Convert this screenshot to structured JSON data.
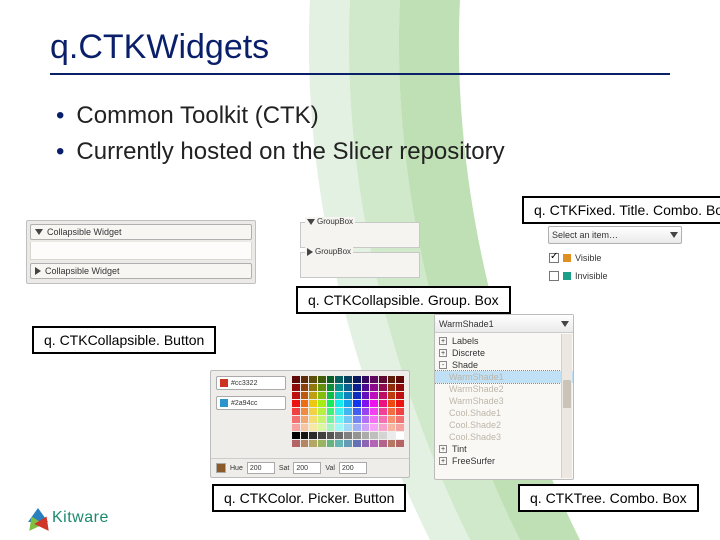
{
  "title": "q.CTKWidgets",
  "bullets": [
    "Common Toolkit (CTK)",
    "Currently hosted on the Slicer repository"
  ],
  "labels": {
    "fixedTitleCombo": "q. CTKFixed. Title. Combo. Box",
    "collapsibleGroup": "q. CTKCollapsible. Group. Box",
    "collapsibleButton": "q. CTKCollapsible. Button",
    "colorPicker": "q. CTKColor. Picker. Button",
    "treeCombo": "q. CTKTree. Combo. Box"
  },
  "collapsibleButton": {
    "item1": "Collapsible Widget",
    "item2": "Collapsible Widget"
  },
  "groupBox": {
    "caption1": "GroupBox",
    "caption2": "GroupBox"
  },
  "fixedTitleCombo": {
    "placeholder": "Select an item…",
    "visible": "Visible",
    "invisible": "Invisible"
  },
  "colorPicker": {
    "chip1": "#cc3322",
    "chip2": "#2a94cc",
    "hue_label": "Hue",
    "sat_label": "Sat",
    "val_label": "Val",
    "hue": "200",
    "sat": "200",
    "val": "200"
  },
  "treeCombo": {
    "selected": "WarmShade1",
    "items": [
      {
        "label": "Labels",
        "top": true,
        "exp": "+"
      },
      {
        "label": "Discrete",
        "top": true,
        "exp": "+"
      },
      {
        "label": "Shade",
        "top": true,
        "exp": "-"
      },
      {
        "label": "WarmShade1",
        "sel": true,
        "dim": true
      },
      {
        "label": "WarmShade2",
        "dim": true
      },
      {
        "label": "WarmShade3",
        "dim": true
      },
      {
        "label": "Cool.Shade1",
        "dim": true
      },
      {
        "label": "Cool.Shade2",
        "dim": true
      },
      {
        "label": "Cool.Shade3",
        "dim": true
      },
      {
        "label": "Tint",
        "top": true,
        "exp": "+"
      },
      {
        "label": "FreeSurfer",
        "top": true,
        "exp": "+"
      }
    ]
  },
  "logo_text": "Kitware"
}
